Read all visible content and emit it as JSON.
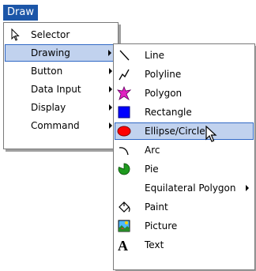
{
  "menubar": {
    "draw": "Draw"
  },
  "menu1": {
    "items": [
      {
        "label": "Selector"
      },
      {
        "label": "Drawing"
      },
      {
        "label": "Button"
      },
      {
        "label": "Data Input"
      },
      {
        "label": "Display"
      },
      {
        "label": "Command"
      }
    ]
  },
  "menu2": {
    "items": [
      {
        "label": "Line"
      },
      {
        "label": "Polyline"
      },
      {
        "label": "Polygon"
      },
      {
        "label": "Rectangle"
      },
      {
        "label": "Ellipse/Circle"
      },
      {
        "label": "Arc"
      },
      {
        "label": "Pie"
      },
      {
        "label": "Equilateral Polygon"
      },
      {
        "label": "Paint"
      },
      {
        "label": "Picture"
      },
      {
        "label": "Text"
      }
    ]
  }
}
